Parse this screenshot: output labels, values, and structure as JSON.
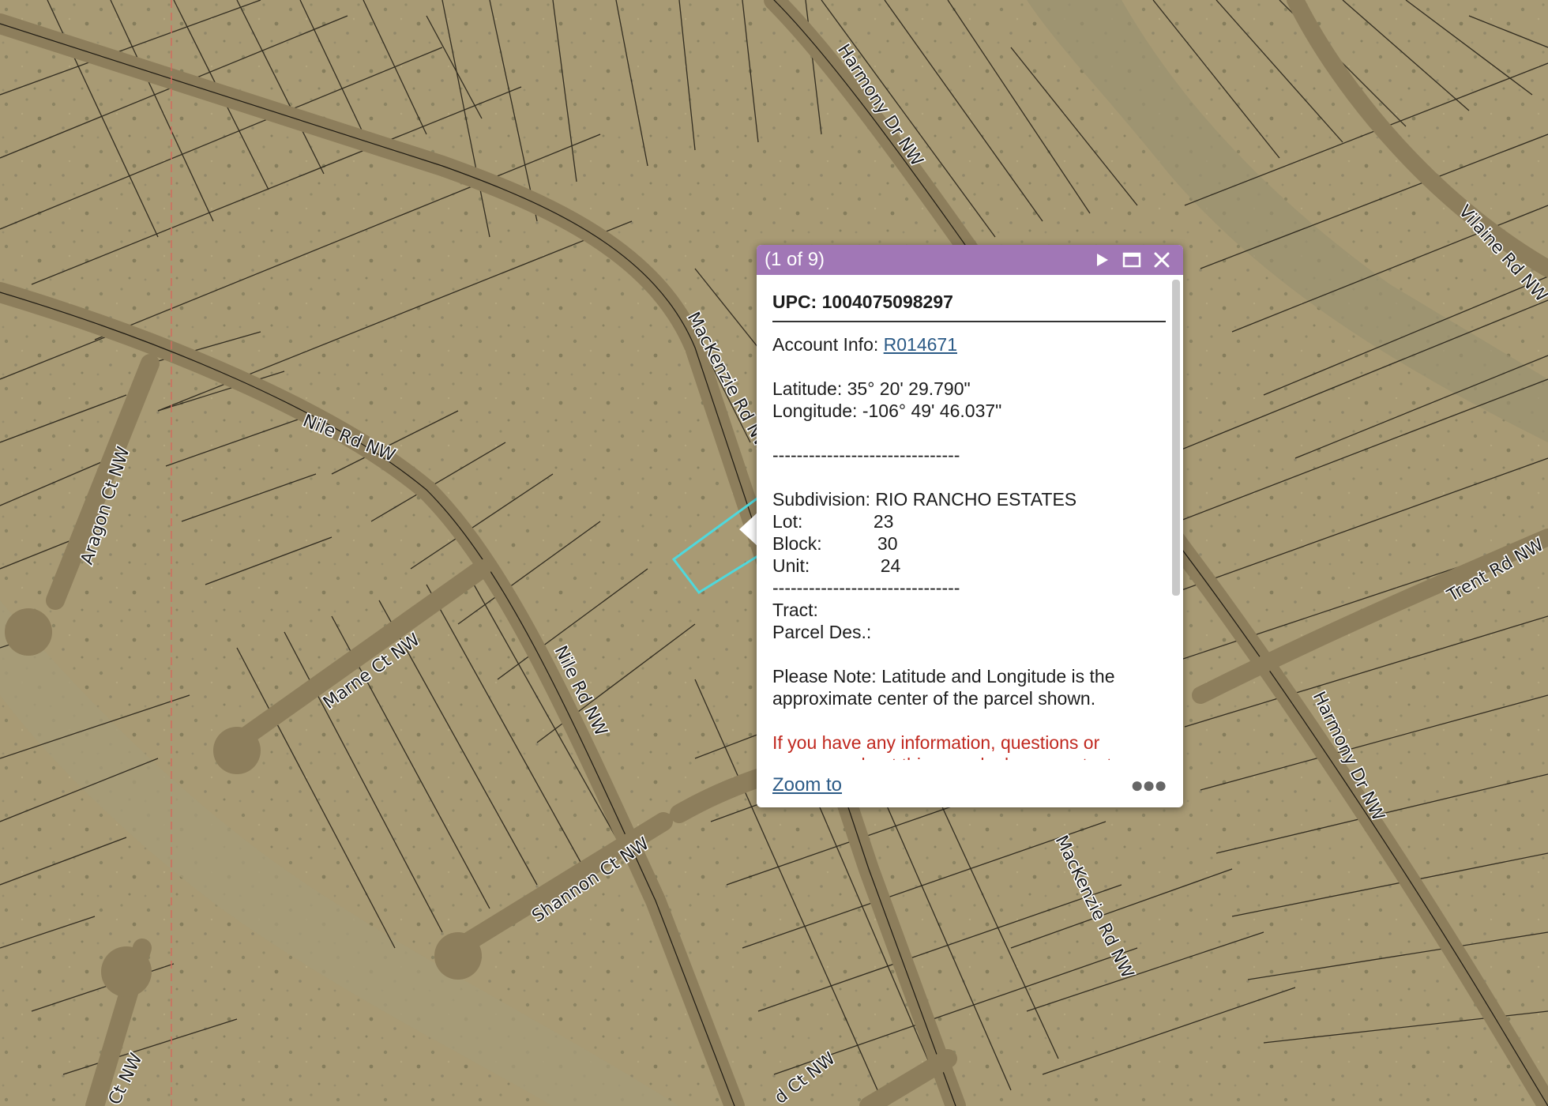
{
  "map": {
    "road_labels": {
      "harmony_dr_1": "Harmony Dr NW",
      "harmony_dr_2": "Harmony Dr NW",
      "mackenzie_rd_1": "MacKenzie Rd NW",
      "mackenzie_rd_2": "MacKenzie Rd NW",
      "nile_rd_1": "Nile Rd NW",
      "nile_rd_2": "Nile Rd NW",
      "aragon_ct": "Aragon Ct NW",
      "marne_ct": "Marne Ct NW",
      "shannon_ct": "Shannon Ct NW",
      "vilaine_rd": "Vilaine Rd NW",
      "trent_rd": "Trent Rd NW",
      "bottom_left_ct": "Ct NW",
      "bottom_mid_ct": "d Ct NW"
    },
    "colors": {
      "terrain": "#a89a74",
      "parcel_line": "#1e1a12",
      "road": "#8d7e5c",
      "selected_parcel": "#4fd8dc",
      "popup_header": "#a177b6"
    }
  },
  "popup": {
    "counter": "(1 of 9)",
    "upc": "UPC: 1004075098297",
    "account_label": "Account Info: ",
    "account_link": "R014671",
    "latitude": "Latitude: 35° 20' 29.790\"",
    "longitude": "Longitude: -106° 49' 46.037\"",
    "separator": "-------------------------------",
    "subdivision": "Subdivision: RIO RANCHO ESTATES",
    "lot": "Lot:              23",
    "block": "Block:           30",
    "unit": "Unit:              24",
    "tract": "Tract:",
    "parcel_des": "Parcel Des.:",
    "note_line1": "Please Note: Latitude and Longitude is the",
    "note_line2": "approximate center of the parcel shown.",
    "contact_line1": "If you have any information, questions or",
    "contact_line2": "concerns about this parcel, please contact",
    "zoom_to": "Zoom to",
    "icons": {
      "next": "play-icon",
      "maximize": "maximize-icon",
      "close": "close-icon",
      "more": "more-icon"
    }
  }
}
